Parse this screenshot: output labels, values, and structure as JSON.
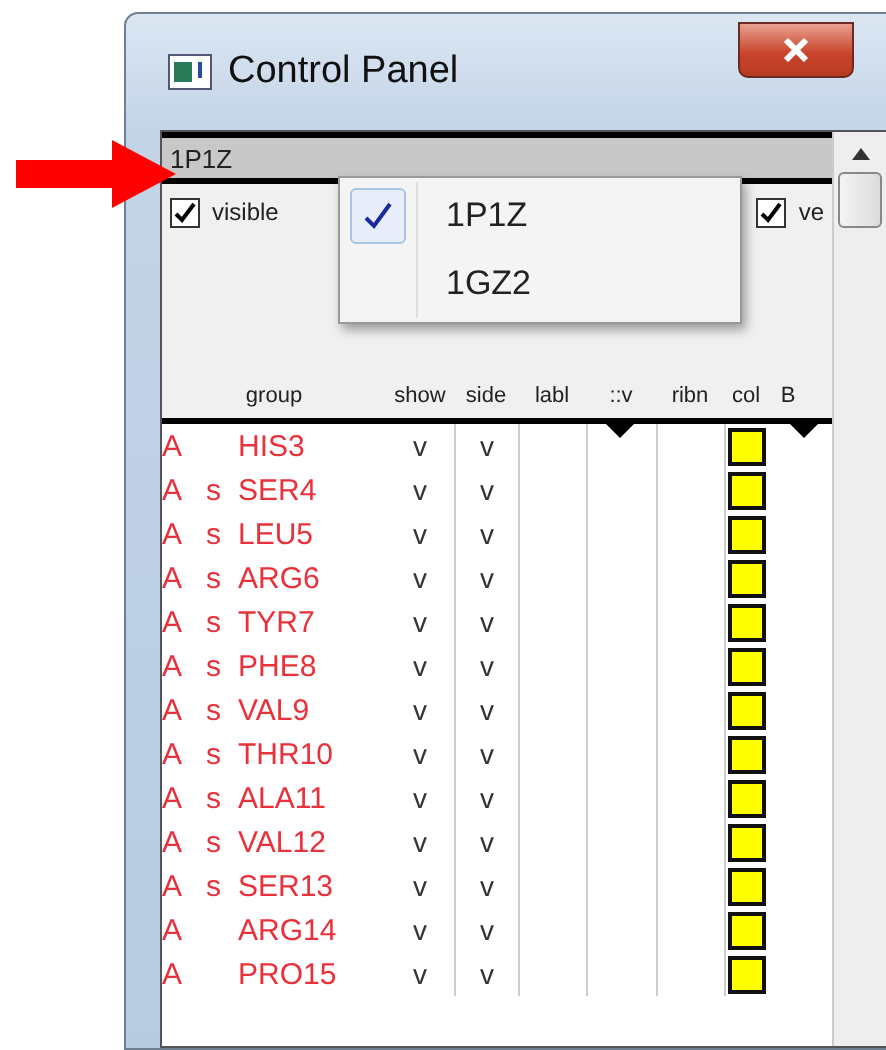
{
  "window": {
    "title": "Control Panel"
  },
  "model_selector": {
    "value": "1P1Z"
  },
  "options": [
    {
      "label": "visible",
      "checked": true
    },
    {
      "label": "ve",
      "checked": true
    }
  ],
  "model_menu": {
    "items": [
      {
        "label": "1P1Z",
        "selected": true
      },
      {
        "label": "1GZ2",
        "selected": false
      }
    ]
  },
  "columns": [
    "group",
    "show",
    "side",
    "labl",
    "::v",
    "ribn",
    "col",
    "B"
  ],
  "rows": [
    {
      "chain": "A",
      "residue": "HIS3",
      "show": "v",
      "side": "v",
      "color": "#ffff00"
    },
    {
      "chain": "A",
      "flag": "s",
      "residue": "SER4",
      "show": "v",
      "side": "v",
      "color": "#ffff00"
    },
    {
      "chain": "A",
      "flag": "s",
      "residue": "LEU5",
      "show": "v",
      "side": "v",
      "color": "#ffff00"
    },
    {
      "chain": "A",
      "flag": "s",
      "residue": "ARG6",
      "show": "v",
      "side": "v",
      "color": "#ffff00"
    },
    {
      "chain": "A",
      "flag": "s",
      "residue": "TYR7",
      "show": "v",
      "side": "v",
      "color": "#ffff00"
    },
    {
      "chain": "A",
      "flag": "s",
      "residue": "PHE8",
      "show": "v",
      "side": "v",
      "color": "#ffff00"
    },
    {
      "chain": "A",
      "flag": "s",
      "residue": "VAL9",
      "show": "v",
      "side": "v",
      "color": "#ffff00"
    },
    {
      "chain": "A",
      "flag": "s",
      "residue": "THR10",
      "show": "v",
      "side": "v",
      "color": "#ffff00"
    },
    {
      "chain": "A",
      "flag": "s",
      "residue": "ALA11",
      "show": "v",
      "side": "v",
      "color": "#ffff00"
    },
    {
      "chain": "A",
      "flag": "s",
      "residue": "VAL12",
      "show": "v",
      "side": "v",
      "color": "#ffff00"
    },
    {
      "chain": "A",
      "flag": "s",
      "residue": "SER13",
      "show": "v",
      "side": "v",
      "color": "#ffff00"
    },
    {
      "chain": "A",
      "residue": "ARG14",
      "show": "v",
      "side": "v",
      "color": "#ffff00"
    },
    {
      "chain": "A",
      "residue": "PRO15",
      "show": "v",
      "side": "v",
      "color": "#ffff00"
    }
  ]
}
